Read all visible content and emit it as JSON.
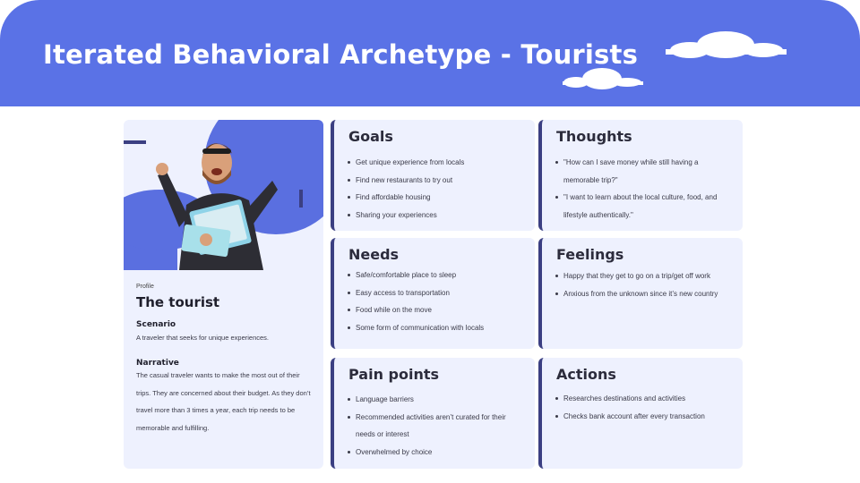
{
  "header": {
    "title": "Iterated Behavioral Archetype - Tourists"
  },
  "profile": {
    "label": "Profile",
    "name": "The tourist",
    "scenario_heading": "Scenario",
    "scenario_text": "A traveler that seeks for unique experiences.",
    "narrative_heading": "Narrative",
    "narrative_text": "The casual traveler wants to make the most out of their trips. They are concerned about their budget. As they don’t travel more than 3 times a year, each trip needs to be memorable and fulfilling."
  },
  "goals": {
    "heading": "Goals",
    "items": [
      "Get unique experience from locals",
      "Find new restaurants to try out",
      "Find affordable housing",
      "Sharing your experiences"
    ]
  },
  "thoughts": {
    "heading": "Thoughts",
    "items": [
      "\"How can I save money while still having a memorable trip?\"",
      "\"I want to learn about the local culture, food, and lifestyle authentically.\""
    ]
  },
  "needs": {
    "heading": "Needs",
    "items": [
      "Safe/comfortable place to sleep",
      "Easy access to transportation",
      "Food while on the move",
      "Some form of communication with locals"
    ]
  },
  "feelings": {
    "heading": "Feelings",
    "items": [
      "Happy that they get to go on a trip/get off work",
      "Anxious from the unknown since it’s new country"
    ]
  },
  "pain_points": {
    "heading": "Pain points",
    "items": [
      "Language barriers",
      "Recommended activities aren’t curated for their needs or interest",
      "Overwhelmed by choice"
    ]
  },
  "actions": {
    "heading": "Actions",
    "items": [
      "Researches destinations and activities",
      "Checks bank account after every transaction"
    ]
  },
  "colors": {
    "header": "#5a72e6",
    "card": "#eef1fe",
    "accent": "#3b3f82",
    "blob": "#5a6fe0"
  }
}
